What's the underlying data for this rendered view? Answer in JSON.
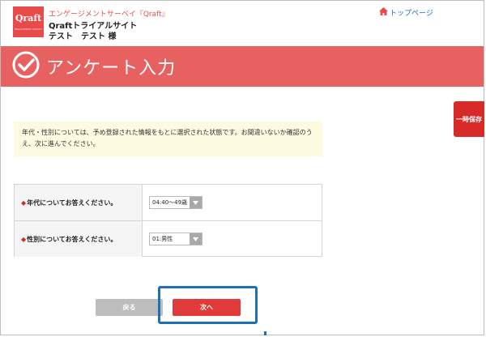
{
  "header": {
    "logo_text": "Qraft",
    "logo_subtext": "ENGAGEMENT SURVEY",
    "survey_name": "エンゲージメントサーベイ『Qraft』",
    "site_name": "Qraftトライアルサイト",
    "user_name": "テスト　テスト 様",
    "top_link": "トップページ"
  },
  "banner": {
    "title": "アンケート入力"
  },
  "save_button": {
    "label": "一時保存"
  },
  "notice": {
    "text": "年代・性別については、予め登録された情報をもとに選択された状態です。お間違いないか確認のうえ、次に進んでください。"
  },
  "form": {
    "required_mark": "◆",
    "rows": [
      {
        "question": "年代についてお答えください。",
        "selected": "04:40〜49歳"
      },
      {
        "question": "性別についてお答えください。",
        "selected": "01:男性"
      }
    ]
  },
  "buttons": {
    "back_label": "戻る",
    "next_label": "次へ"
  },
  "colors": {
    "brand": "#e94b4b",
    "banner": "#e86161",
    "link": "#2a6cc7",
    "highlight": "#1d6fb8"
  }
}
